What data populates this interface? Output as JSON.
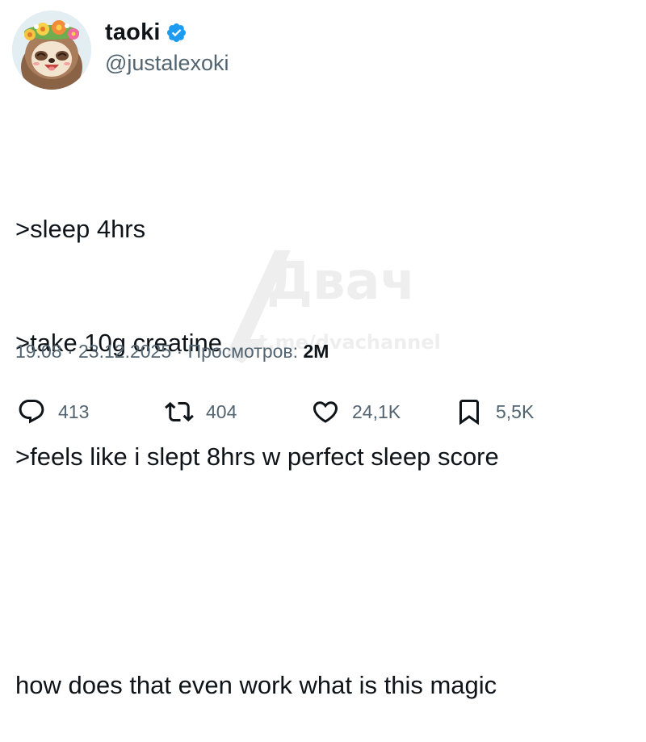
{
  "author": {
    "display_name": "taoki",
    "handle": "@justalexoki",
    "verified": true,
    "avatar_icon": "sloth-avatar-icon"
  },
  "tweet": {
    "lines": [
      ">sleep 4hrs",
      ">take 10g creatine",
      ">feels like i slept 8hrs w perfect sleep score",
      "",
      "how does that even work what is this magic"
    ]
  },
  "meta": {
    "time": "19:08",
    "date": "23.12.2025",
    "views_label": "Просмотров:",
    "views_count": "2M"
  },
  "actions": {
    "replies": "413",
    "reposts": "404",
    "likes": "24,1K",
    "bookmarks": "5,5K"
  },
  "watermark": {
    "text": "Двач",
    "subtext": "t.me/dvachannel"
  },
  "colors": {
    "text": "#0f1419",
    "secondary": "#536471",
    "verified": "#1d9bf0"
  }
}
